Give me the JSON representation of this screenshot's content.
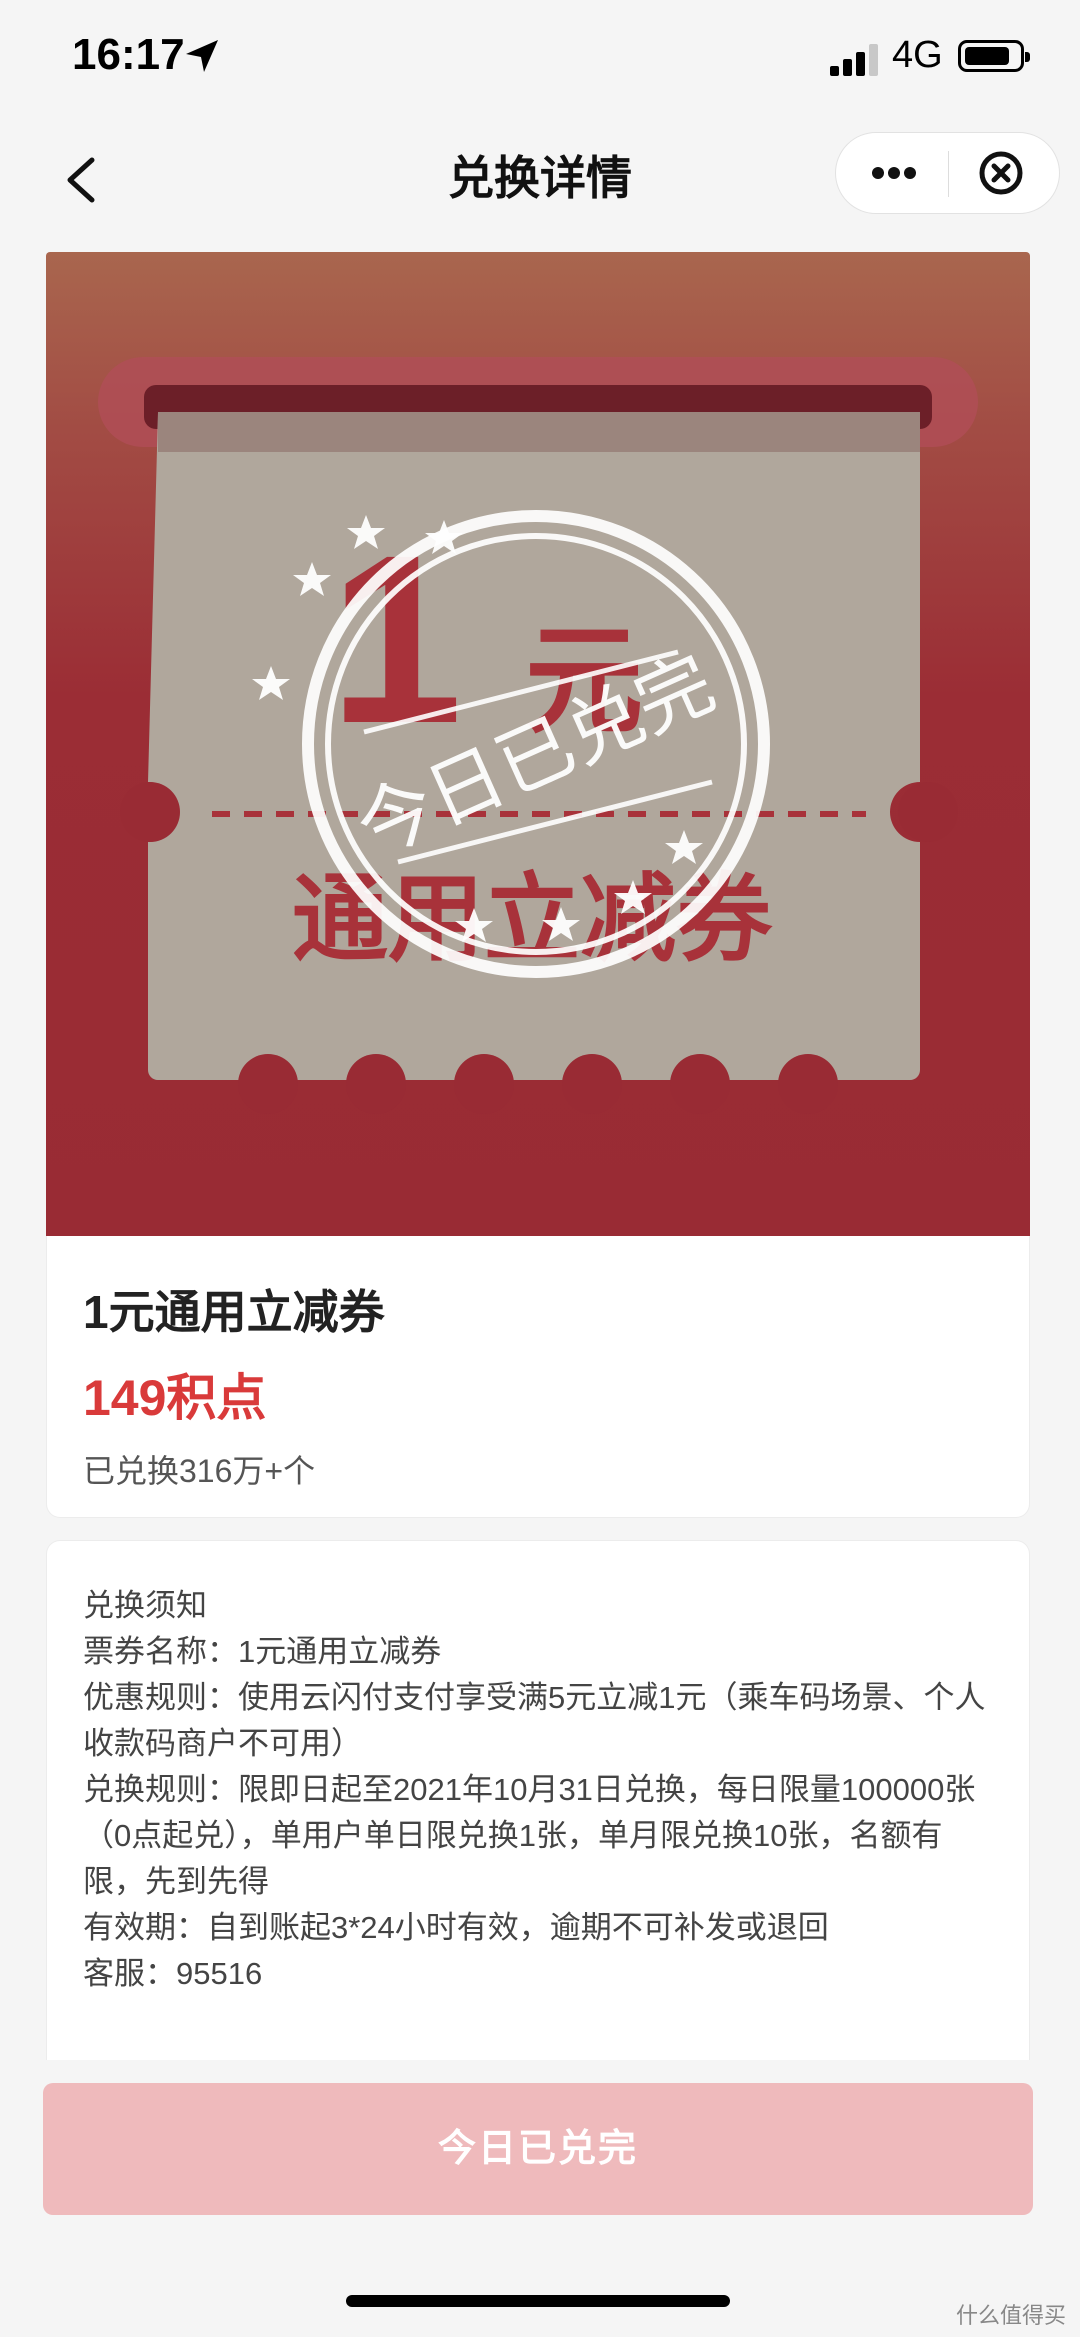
{
  "status": {
    "time": "16:17",
    "network": "4G",
    "icons": [
      "location-arrow-icon",
      "signal-icon",
      "battery-icon"
    ]
  },
  "nav": {
    "title": "兑换详情",
    "back_icon": "chevron-left-icon",
    "more_icon": "more-dots-icon",
    "close_icon": "close-circle-icon"
  },
  "coupon_image": {
    "amount": "1",
    "unit": "元",
    "coupon_type": "通用立减券",
    "stamp_text": "今日已兑完",
    "colors": {
      "background": "#9b2d35",
      "ticket": "#b0a79c",
      "stamp": "#ffffff"
    }
  },
  "product": {
    "name": "1元通用立减券",
    "price": "149积点",
    "redeemed": "已兑换316万+个"
  },
  "notice": {
    "title": "兑换须知",
    "lines": [
      "票券名称：1元通用立减券",
      "优惠规则：使用云闪付支付享受满5元立减1元（乘车码场景、个人收款码商户不可用）",
      "兑换规则：限即日起至2021年10月31日兑换，每日限量100000张（0点起兑），单用户单日限兑换1张，单月限兑换10张，名额有限，先到先得",
      "有效期：自到账起3*24小时有效，逾期不可补发或退回",
      "客服：95516"
    ]
  },
  "cta": {
    "label": "今日已兑完",
    "state": "disabled",
    "color": "#efbabc"
  },
  "watermark": "什么值得买"
}
